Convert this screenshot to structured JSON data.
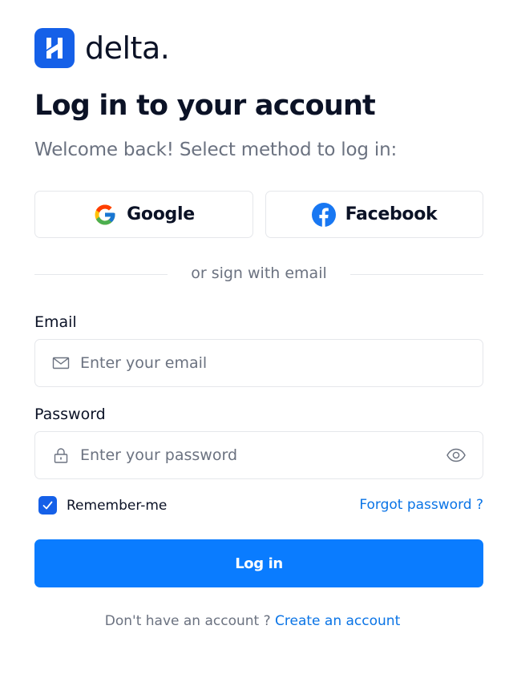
{
  "brand": {
    "name": "delta.",
    "logo_icon": "delta-logo-icon",
    "color": "#1560e8"
  },
  "heading": {
    "title": "Log in to your account",
    "subtitle": "Welcome back! Select method to log in:"
  },
  "social": {
    "google": {
      "label": "Google",
      "icon": "google-icon"
    },
    "facebook": {
      "label": "Facebook",
      "icon": "facebook-icon",
      "color": "#1877f2"
    }
  },
  "divider": {
    "text": "or sign with email"
  },
  "form": {
    "email": {
      "label": "Email",
      "placeholder": "Enter your email",
      "value": "",
      "icon": "mail-icon"
    },
    "password": {
      "label": "Password",
      "placeholder": "Enter your password",
      "value": "",
      "icon": "lock-icon",
      "toggle_icon": "eye-icon"
    },
    "remember": {
      "label": "Remember-me",
      "checked": true
    },
    "forgot_label": "Forgot password ?",
    "submit_label": "Log in"
  },
  "footer": {
    "prompt": "Don't have an account ?",
    "link_label": "Create an account"
  },
  "colors": {
    "primary": "#0a7cff",
    "link": "#0a74e6",
    "text": "#0b1226",
    "muted": "#6b7280",
    "border": "#e5e7eb"
  }
}
